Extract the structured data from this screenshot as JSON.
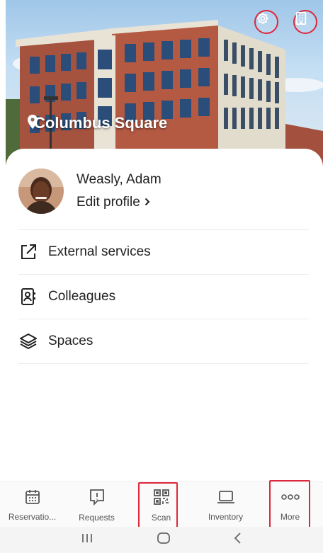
{
  "hero": {
    "location_name": "Columbus Square",
    "icons": {
      "location": "location-pin-icon",
      "settings": "gear-icon",
      "building": "building-icon"
    }
  },
  "profile": {
    "name": "Weasly, Adam",
    "edit_label": "Edit profile",
    "edit_icon": "chevron-right-icon"
  },
  "menu": {
    "items": [
      {
        "label": "External services",
        "icon": "external-link-icon"
      },
      {
        "label": "Colleagues",
        "icon": "contact-card-icon"
      },
      {
        "label": "Spaces",
        "icon": "layers-icon"
      }
    ]
  },
  "bottom_nav": {
    "items": [
      {
        "label": "Reservatio...",
        "icon": "calendar-icon"
      },
      {
        "label": "Requests",
        "icon": "message-alert-icon"
      },
      {
        "label": "Scan",
        "icon": "qr-code-icon"
      },
      {
        "label": "Inventory",
        "icon": "laptop-icon"
      },
      {
        "label": "More",
        "icon": "more-dots-icon"
      }
    ]
  },
  "system_nav": {
    "icons": [
      "recent-apps-icon",
      "home-icon",
      "back-icon"
    ]
  },
  "colors": {
    "highlight": "#e0263a",
    "brick": "#a5523f",
    "sky": "#9fc6e8"
  }
}
